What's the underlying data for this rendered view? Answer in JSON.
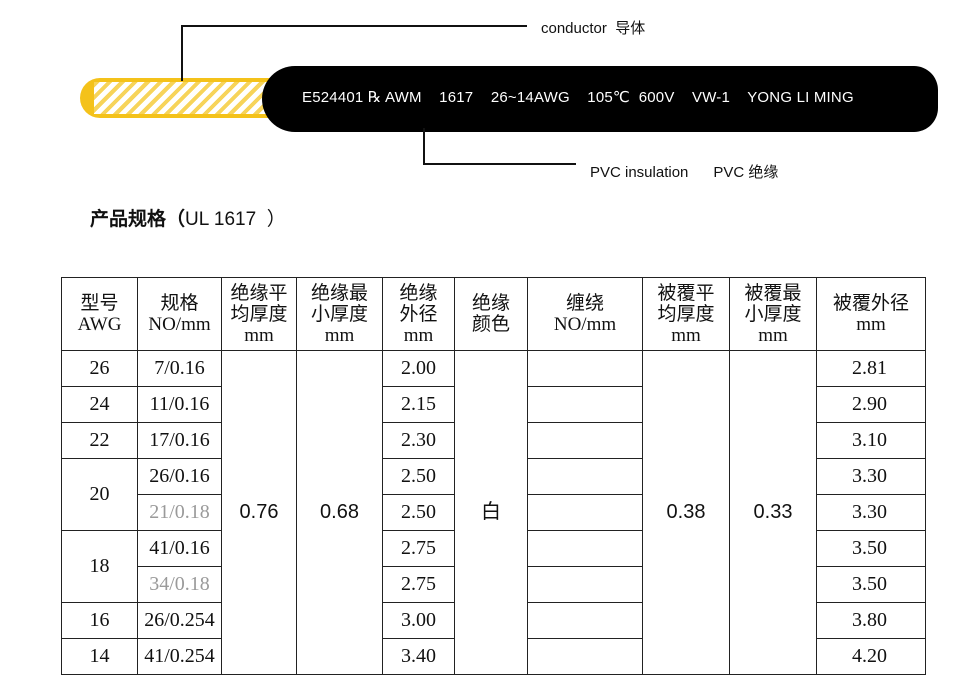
{
  "cable": {
    "print_text": "E524401 ℞ AWM    1617    26~14AWG    105℃  600V    VW-1    YONG LI MING",
    "conductor_label": "conductor  导体",
    "insulation_label": "PVC insulation      PVC 绝缘",
    "colors": {
      "conductor": "#f4c21a",
      "jacket": "#000000"
    }
  },
  "heading": {
    "prefix": "产品规格（",
    "model": "UL 1617",
    "suffix": "  ）"
  },
  "table": {
    "headers": [
      [
        "型号",
        "AWG"
      ],
      [
        "规格",
        "NO/mm"
      ],
      [
        "绝缘平",
        "均厚度",
        "mm"
      ],
      [
        "绝缘最",
        "小厚度",
        "mm"
      ],
      [
        "绝缘",
        "外径",
        "mm"
      ],
      [
        "绝缘",
        "颜色"
      ],
      [
        "缠绕",
        "NO/mm"
      ],
      [
        "被覆平",
        "均厚度",
        "mm"
      ],
      [
        "被覆最",
        "小厚度",
        "mm"
      ],
      [
        "被覆外径",
        "mm"
      ]
    ],
    "awg": [
      "26",
      "24",
      "22",
      "20",
      "18",
      "16",
      "14"
    ],
    "spec": [
      "7/0.16",
      "11/0.16",
      "17/0.16",
      "26/0.16",
      "21/0.18",
      "41/0.16",
      "34/0.18",
      "26/0.254",
      "41/0.254"
    ],
    "ins_avg": "0.76",
    "ins_min": "0.68",
    "ins_od": [
      "2.00",
      "2.15",
      "2.30",
      "2.50",
      "2.50",
      "2.75",
      "2.75",
      "3.00",
      "3.40"
    ],
    "color": "白",
    "jacket_avg": "0.38",
    "jacket_min": "0.33",
    "jacket_od": [
      "2.81",
      "2.90",
      "3.10",
      "3.30",
      "3.30",
      "3.50",
      "3.50",
      "3.80",
      "4.20"
    ]
  }
}
